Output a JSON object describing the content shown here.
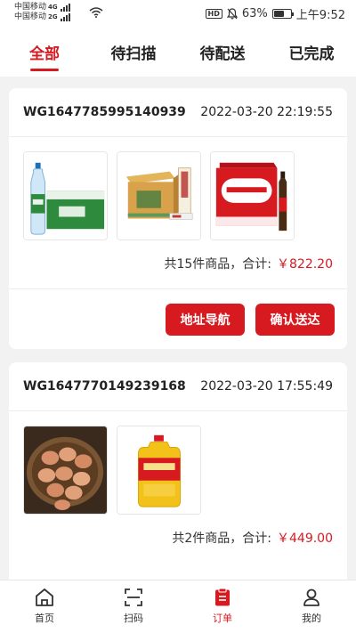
{
  "status_bar": {
    "carrier1": "中国移动",
    "carrier1_net": "4G",
    "carrier2": "中国移动",
    "carrier2_net": "2G",
    "hd_badge": "HD",
    "battery_text": "63%",
    "battery_level": 0.63,
    "time": "上午9:52"
  },
  "tabs": [
    {
      "label": "全部",
      "active": true
    },
    {
      "label": "待扫描",
      "active": false
    },
    {
      "label": "待配送",
      "active": false
    },
    {
      "label": "已完成",
      "active": false
    }
  ],
  "orders": [
    {
      "order_no": "WG1647785995140939",
      "time": "2022-03-20 22:19:55",
      "products": [
        "bottled-water-case",
        "baijiu-case",
        "budweiser-case"
      ],
      "count_text": "共15件商品，合计:",
      "amount": "￥822.20",
      "buttons": [
        "地址导航",
        "确认送达"
      ]
    },
    {
      "order_no": "WG1647770149239168",
      "time": "2022-03-20 17:55:49",
      "products": [
        "eggs-basket",
        "cooking-oil-bottle"
      ],
      "count_text": "共2件商品，合计:",
      "amount": "￥449.00"
    }
  ],
  "bottom_nav": [
    {
      "label": "首页",
      "icon": "home-icon",
      "active": false
    },
    {
      "label": "扫码",
      "icon": "scan-icon",
      "active": false
    },
    {
      "label": "订单",
      "icon": "order-icon",
      "active": true
    },
    {
      "label": "我的",
      "icon": "profile-icon",
      "active": false
    }
  ],
  "colors": {
    "accent": "#d71920",
    "background": "#f2f2f2"
  }
}
